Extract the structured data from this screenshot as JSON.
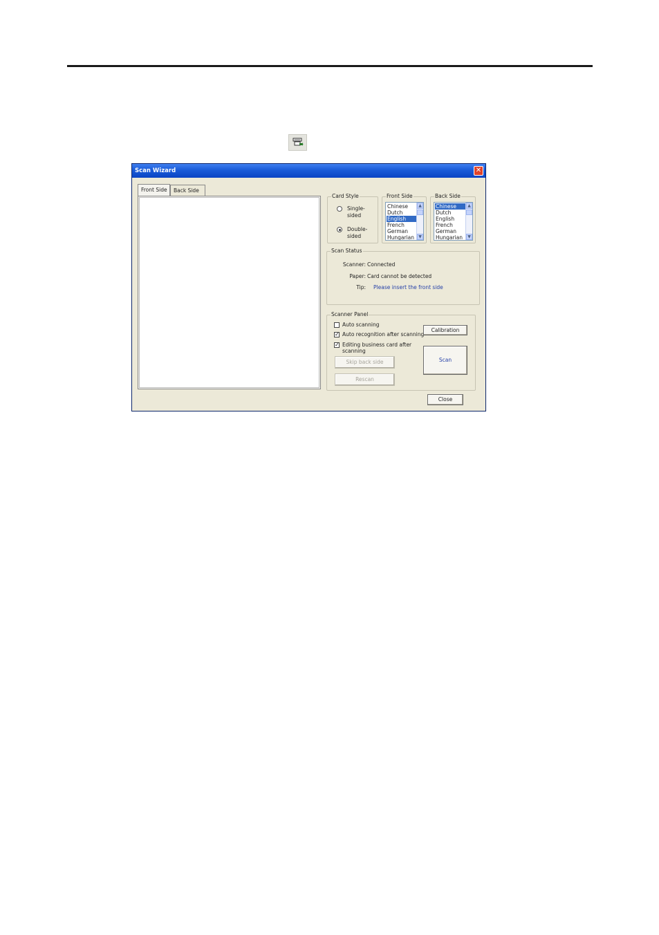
{
  "window": {
    "title": "Scan Wizard",
    "close_glyph": "✕"
  },
  "tabs": [
    {
      "label": "Front Side",
      "active": true
    },
    {
      "label": "Back Side",
      "active": false
    }
  ],
  "card_style": {
    "legend": "Card Style",
    "options": [
      {
        "label": "Single-\nsided",
        "line1": "Single-",
        "line2": "sided",
        "selected": false
      },
      {
        "label": "Double-\nsided",
        "line1": "Double-",
        "line2": "sided",
        "selected": true
      }
    ]
  },
  "front_side": {
    "legend": "Front Side",
    "items": [
      "Chinese",
      "Dutch",
      "English",
      "French",
      "German",
      "Hungarian"
    ],
    "selected": "English"
  },
  "back_side": {
    "legend": "Back Side",
    "items": [
      "Chinese",
      "Dutch",
      "English",
      "French",
      "German",
      "Hungarian"
    ],
    "selected": "Chinese"
  },
  "scan_status": {
    "legend": "Scan Status",
    "scanner_label": "Scanner:",
    "scanner_value": "Connected",
    "paper_label": "Paper:",
    "paper_value": "Card cannot be detected",
    "tip_label": "Tip:",
    "tip_value": "Please insert the front side"
  },
  "scanner_panel": {
    "legend": "Scanner Panel",
    "auto_scanning": {
      "label": "Auto scanning",
      "checked": false
    },
    "auto_recognition": {
      "label": "Auto recognition after scanning",
      "checked": true
    },
    "editing_card": {
      "line1": "Editing business card after",
      "line2": "scanning",
      "checked": true
    },
    "skip_back_side": "Skip back side",
    "rescan": "Rescan",
    "calibration": "Calibration",
    "scan": "Scan"
  },
  "close_button": "Close",
  "colors": {
    "titlebar": "#1a5bd8",
    "dialog_bg": "#ece9d8",
    "selection": "#316ac5",
    "tip_text": "#2540a8"
  },
  "icons": {
    "toolbar": "scan-wizard-icon",
    "close": "close-icon"
  }
}
